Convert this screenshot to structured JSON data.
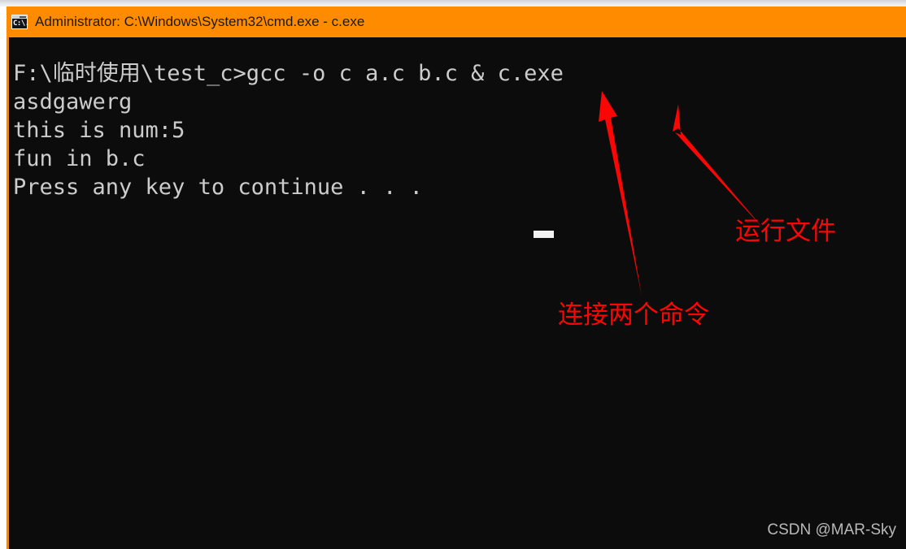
{
  "window": {
    "title": "Administrator: C:\\Windows\\System32\\cmd.exe - c.exe",
    "icon": "cmd-console-icon",
    "icon_glyph": "C:\\.",
    "titlebar_color": "#ff8c00",
    "console_background": "#0c0c0c",
    "console_text_color": "#cccccc"
  },
  "console": {
    "lines": [
      "F:\\临时使用\\test_c>gcc -o c a.c b.c & c.exe",
      "asdgawerg",
      "this is num:5",
      "fun in b.c",
      "Press any key to continue . . . "
    ],
    "text": "F:\\临时使用\\test_c>gcc -o c a.c b.c & c.exe\nasdgawerg\nthis is num:5\nfun in b.c\nPress any key to continue . . . ",
    "prompt_path": "F:\\临时使用\\test_c>",
    "command": "gcc -o c a.c b.c & c.exe",
    "cursor_visible": true
  },
  "annotations": {
    "color": "#fb0505",
    "items": [
      {
        "label": "运行文件",
        "name": "annotation-run-file",
        "target": "c.exe"
      },
      {
        "label": "连接两个命令",
        "name": "annotation-chain-commands",
        "target": "&"
      }
    ]
  },
  "watermark": {
    "text": "CSDN @MAR-Sky"
  }
}
